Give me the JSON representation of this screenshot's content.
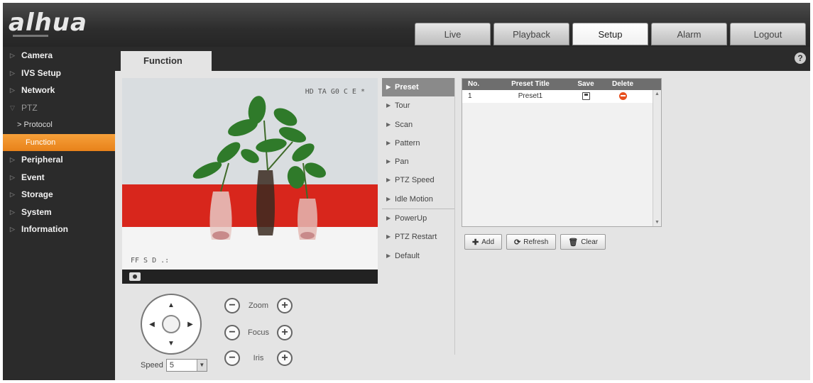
{
  "brand": {
    "logo_text": "alhua"
  },
  "top_tabs": [
    {
      "label": "Live"
    },
    {
      "label": "Playback"
    },
    {
      "label": "Setup"
    },
    {
      "label": "Alarm"
    },
    {
      "label": "Logout"
    }
  ],
  "sidebar": {
    "items": [
      {
        "label": "Camera"
      },
      {
        "label": "IVS Setup"
      },
      {
        "label": "Network"
      },
      {
        "label": "PTZ"
      },
      {
        "label": "> Protocol"
      },
      {
        "label": "Function"
      },
      {
        "label": "Peripheral"
      },
      {
        "label": "Event"
      },
      {
        "label": "Storage"
      },
      {
        "label": "System"
      },
      {
        "label": "Information"
      }
    ]
  },
  "content_tab": {
    "label": "Function"
  },
  "help": {
    "label": "?"
  },
  "video": {
    "osd_top": "HD TA G0 C E *",
    "osd_bottom": "FF S D .:"
  },
  "ptz": {
    "speed_label": "Speed",
    "speed_value": "5",
    "zoom_label": "Zoom",
    "focus_label": "Focus",
    "iris_label": "Iris",
    "minus": "−",
    "plus": "+"
  },
  "functions": [
    {
      "label": "Preset"
    },
    {
      "label": "Tour"
    },
    {
      "label": "Scan"
    },
    {
      "label": "Pattern"
    },
    {
      "label": "Pan"
    },
    {
      "label": "PTZ Speed"
    },
    {
      "label": "Idle Motion"
    },
    {
      "label": "PowerUp"
    },
    {
      "label": "PTZ Restart"
    },
    {
      "label": "Default"
    }
  ],
  "preset_table": {
    "headers": {
      "no": "No.",
      "title": "Preset Title",
      "save": "Save",
      "delete": "Delete"
    },
    "rows": [
      {
        "no": "1",
        "title": "Preset1"
      }
    ]
  },
  "buttons": {
    "add": "Add",
    "refresh": "Refresh",
    "clear": "Clear"
  }
}
